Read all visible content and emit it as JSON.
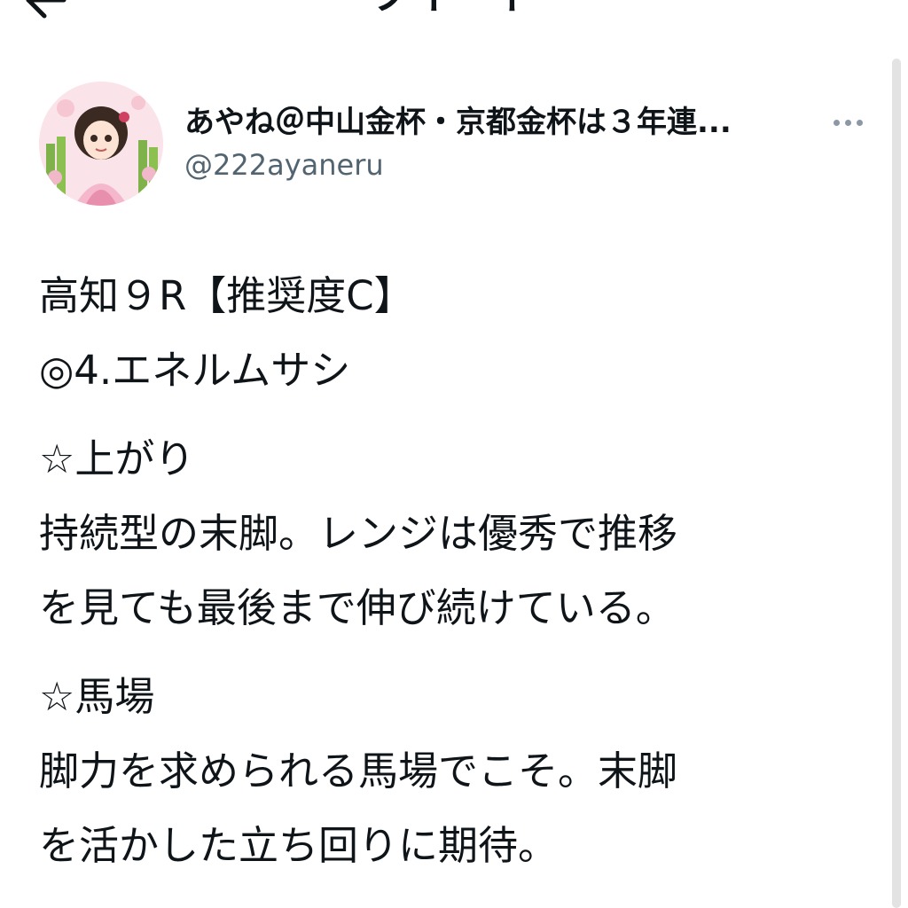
{
  "header": {
    "title": "ツイート",
    "back_icon": "arrow-left-icon"
  },
  "author": {
    "display_name": "あやね＠中山金杯・京都金杯は３年連...",
    "handle": "@222ayaneru",
    "avatar_icon": "avatar-illustration",
    "more_icon": "more-horizontal-icon"
  },
  "tweet": {
    "line1": "高知９R【推奨度C】",
    "line2": "◎4.エネルムサシ",
    "line3": "☆上がり",
    "line4": "持続型の末脚。レンジは優秀で推移",
    "line5": "を見ても最後まで伸び続けている。",
    "line6": "☆馬場",
    "line7": "脚力を求められる馬場でこそ。末脚",
    "line8": "を活かした立ち回りに期待。"
  },
  "colors": {
    "text": "#0f1419",
    "secondary": "#536471",
    "background": "#ffffff"
  }
}
